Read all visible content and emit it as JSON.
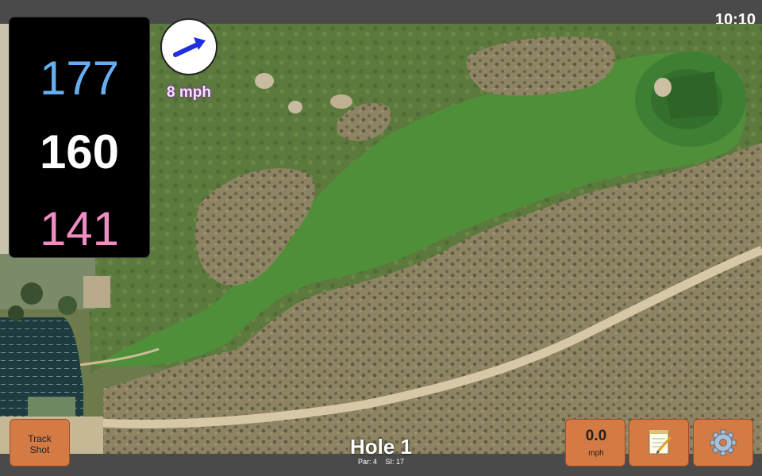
{
  "status": {
    "time": "10:10"
  },
  "distances": {
    "back": "177",
    "center": "160",
    "front": "141"
  },
  "wind": {
    "speed_label": "8 mph",
    "direction": "east-north-east",
    "icon": "wind-arrow-icon"
  },
  "hole": {
    "title": "Hole 1",
    "par": "Par: 4",
    "stroke_index": "SI: 17"
  },
  "buttons": {
    "track_shot": "Track\nShot",
    "speed_value": "0.0",
    "speed_unit": "mph",
    "notes_icon": "notepad-icon",
    "settings_icon": "gear-icon"
  },
  "colors": {
    "back_distance": "#66aef0",
    "center_distance": "#ffffff",
    "front_distance": "#f08cc4",
    "button_bg": "#d37a45",
    "bar_bg": "#4a4a4a",
    "fairway": "#4f8f3a",
    "desert": "#8b8162",
    "cart_path": "#d6c7a6"
  }
}
